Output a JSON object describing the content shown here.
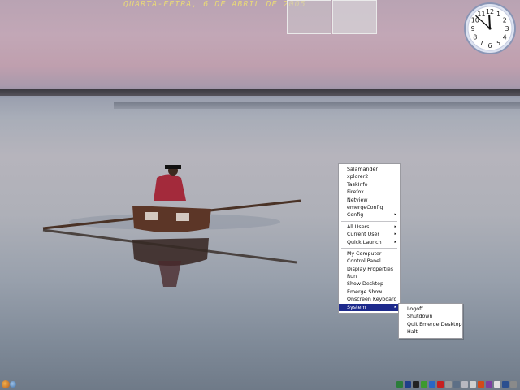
{
  "desktop": {
    "date_text": "QUARTA-FEIRA, 6 DE ABRIL DE 2005",
    "pager": {
      "desktops": 2
    },
    "clock": {
      "numerals": [
        "12",
        "1",
        "2",
        "3",
        "4",
        "5",
        "6",
        "7",
        "8",
        "9",
        "10",
        "11"
      ],
      "hour": 11.9,
      "minute": 52
    }
  },
  "main_menu": {
    "groups": [
      [
        {
          "label": "Salamander"
        },
        {
          "label": "xplorer2"
        },
        {
          "label": "TaskInfo"
        },
        {
          "label": "Firefox"
        },
        {
          "label": "Netview"
        },
        {
          "label": "emergeConfig"
        },
        {
          "label": "Config",
          "submenu": true
        }
      ],
      [
        {
          "label": "All Users",
          "submenu": true
        },
        {
          "label": "Current User",
          "submenu": true
        },
        {
          "label": "Quick Launch",
          "submenu": true
        }
      ],
      [
        {
          "label": "My Computer"
        },
        {
          "label": "Control Panel"
        },
        {
          "label": "Display Properties"
        },
        {
          "label": "Run"
        },
        {
          "label": "Show Desktop"
        },
        {
          "label": "Emerge Show"
        },
        {
          "label": "Onscreen Keyboard"
        },
        {
          "label": "System",
          "submenu": true,
          "highlighted": true
        }
      ]
    ],
    "submenu_arrow": "▸"
  },
  "system_submenu": {
    "items": [
      "Logoff",
      "Shutdown",
      "Quit Emerge Desktop",
      "Halt"
    ]
  },
  "taskbar": {
    "tray_icons": [
      {
        "name": "monitor-icon",
        "color": "#2b7d3a"
      },
      {
        "name": "globe-icon",
        "color": "#1e3f8a"
      },
      {
        "name": "terminal-icon",
        "color": "#222222"
      },
      {
        "name": "leaf-icon",
        "color": "#3d9a2e"
      },
      {
        "name": "network-icon",
        "color": "#2a66c4"
      },
      {
        "name": "stop-icon",
        "color": "#c82020"
      },
      {
        "name": "folder-icon",
        "color": "#9a9a9a"
      },
      {
        "name": "disk-icon",
        "color": "#5d6f86"
      },
      {
        "name": "cd-icon",
        "color": "#b8b8c0"
      },
      {
        "name": "star-icon",
        "color": "#d0d0d0"
      },
      {
        "name": "fire-icon",
        "color": "#d24a1a"
      },
      {
        "name": "bell-icon",
        "color": "#7c3fa0"
      },
      {
        "name": "speaker-icon",
        "color": "#e0e0e0"
      },
      {
        "name": "window-icon",
        "color": "#2b4f8f"
      },
      {
        "name": "volume-icon",
        "color": "#8a8a8a"
      }
    ]
  }
}
